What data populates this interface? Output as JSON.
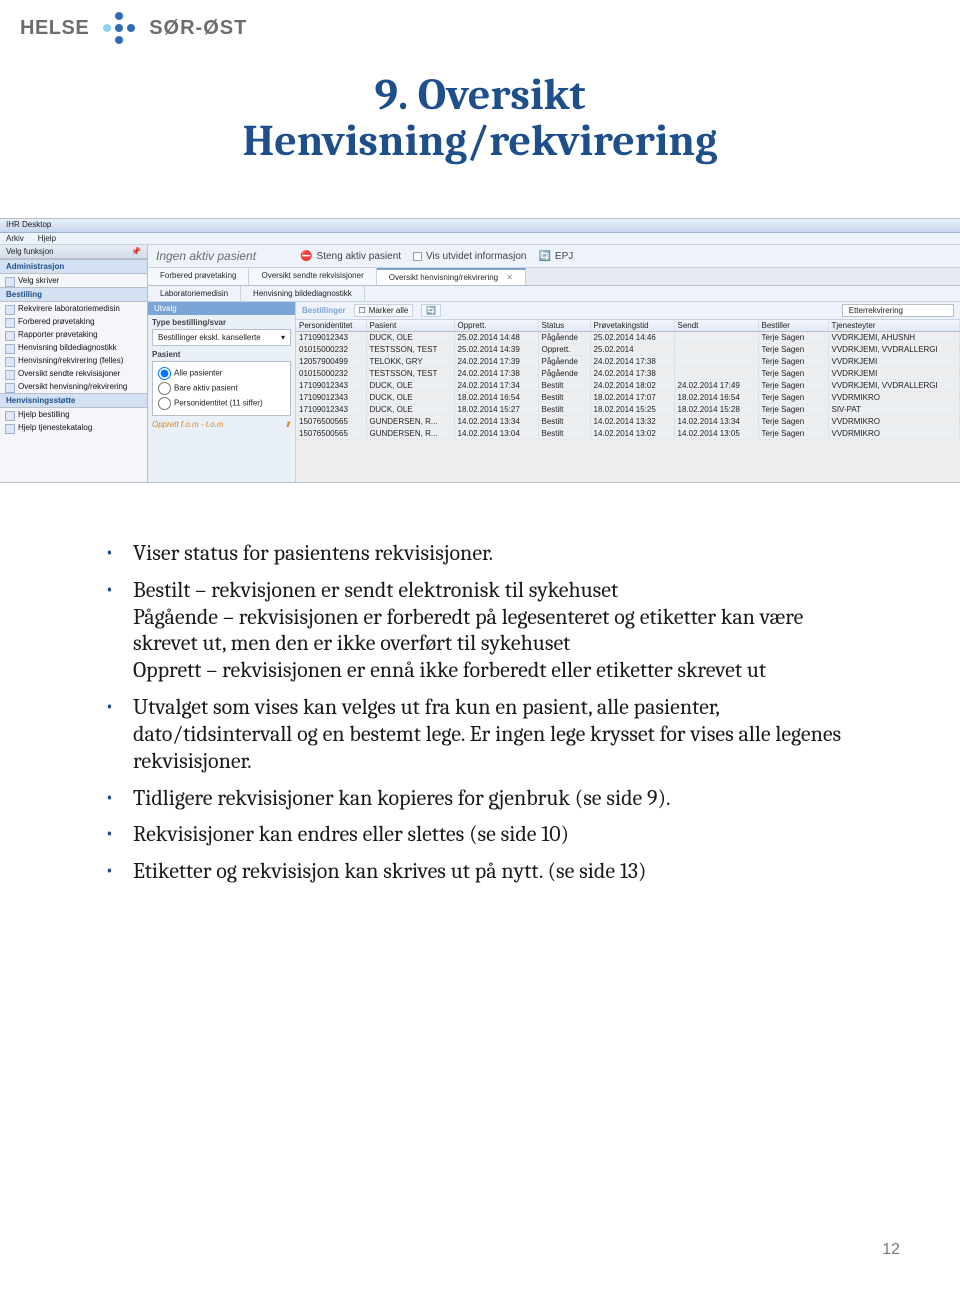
{
  "logo": {
    "left": "HELSE",
    "right": "SØR-ØST"
  },
  "title": {
    "line1": "9. Oversikt",
    "line2": "Henvisning/rekvirering"
  },
  "app": {
    "window_title": "IHR Desktop",
    "menus": [
      "Arkiv",
      "Hjelp"
    ],
    "sidebar": {
      "velg_funksjon_label": "Velg funksjon",
      "sections": [
        {
          "name": "Administrasjon",
          "items": [
            "Velg skriver"
          ]
        },
        {
          "name": "Bestilling",
          "items": [
            "Rekvirere laboratoriemedisin",
            "Forbered prøvetaking",
            "Rapporter prøvetaking",
            "Henvisning bildediagnostikk",
            "Henvisning/rekvirering (felles)",
            "Oversikt sendte rekvisisjoner",
            "Oversikt henvisning/rekvirering"
          ]
        },
        {
          "name": "Henvisningsstøtte",
          "items": [
            "Hjelp bestilling",
            "Hjelp tjenestekatalog"
          ]
        }
      ]
    },
    "patient_bar": {
      "no_active": "Ingen aktiv pasient",
      "close_pat": "Steng aktiv pasient",
      "show_ext": "Vis utvidet informasjon",
      "epj": "EPJ"
    },
    "tabs_row1": [
      "Forbered prøvetaking",
      "Oversikt sendte rekvisisjoner",
      "Oversikt henvisning/rekvirering"
    ],
    "tabs_row1_active": 2,
    "tabs_row2": [
      "Laboratoriemedisin",
      "Henvisning bildediagnostikk"
    ],
    "utvalg": {
      "title": "Utvalg",
      "type_label": "Type bestilling/svar",
      "type_value": "Bestillinger ekskl. kansellerte",
      "pasient_label": "Pasient",
      "radios": [
        {
          "label": "Alle pasienter",
          "checked": true
        },
        {
          "label": "Bare aktiv pasient",
          "checked": false
        },
        {
          "label": "Personidentitet (11 siffer)",
          "checked": false
        }
      ],
      "opprett_label": "Opprett f.o.m - t.o.m"
    },
    "toolbar": {
      "bestillinger": "Bestillinger",
      "marker_alle": "Marker alle",
      "etterrekvirering": "Etterrekvirering"
    },
    "columns": [
      "Personidentitet",
      "Pasient",
      "Opprett.",
      "Status",
      "Prøvetakingstid",
      "Sendt",
      "Bestiller",
      "Tjenesteyter"
    ],
    "rows": [
      [
        "17109012343",
        "DUCK, OLE",
        "25.02.2014 14:48",
        "Pågående",
        "25.02.2014 14:46",
        "",
        "Terje Sagen",
        "VVDRKJEMI, AHUSNH"
      ],
      [
        "01015000232",
        "TESTSSON, TEST",
        "25.02.2014 14:39",
        "Opprett.",
        "25.02.2014",
        "",
        "Terje Sagen",
        "VVDRKJEMI, VVDRALLERGI"
      ],
      [
        "12057900499",
        "TELOKK, GRY",
        "24.02.2014 17:39",
        "Pågående",
        "24.02.2014 17:38",
        "",
        "Terje Sagen",
        "VVDRKJEMI"
      ],
      [
        "01015000232",
        "TESTSSON, TEST",
        "24.02.2014 17:38",
        "Pågående",
        "24.02.2014 17:38",
        "",
        "Terje Sagen",
        "VVDRKJEMI"
      ],
      [
        "17109012343",
        "DUCK, OLE",
        "24.02.2014 17:34",
        "Bestilt",
        "24.02.2014 18:02",
        "24.02.2014 17:49",
        "Terje Sagen",
        "VVDRKJEMI, VVDRALLERGI"
      ],
      [
        "17109012343",
        "DUCK, OLE",
        "18.02.2014 16:54",
        "Bestilt",
        "18.02.2014 17:07",
        "18.02.2014 16:54",
        "Terje Sagen",
        "VVDRMIKRO"
      ],
      [
        "17109012343",
        "DUCK, OLE",
        "18.02.2014 15:27",
        "Bestilt",
        "18.02.2014 15:25",
        "18.02.2014 15:28",
        "Terje Sagen",
        "SIV-PAT"
      ],
      [
        "15076500565",
        "GUNDERSEN, R...",
        "14.02.2014 13:34",
        "Bestilt",
        "14.02.2014 13:32",
        "14.02.2014 13:34",
        "Terje Sagen",
        "VVDRMIKRO"
      ],
      [
        "15076500565",
        "GUNDERSEN, R...",
        "14.02.2014 13:04",
        "Bestilt",
        "14.02.2014 13:02",
        "14.02.2014 13:05",
        "Terje Sagen",
        "VVDRMIKRO"
      ]
    ]
  },
  "bullets": {
    "b1": "Viser status for pasientens rekvisisjoner.",
    "b2_lead": "Bestilt",
    "b2_rest": " rekvisjonen er sendt elektronisk til sykehuset",
    "b3_lead": "Pågående",
    "b3_rest": " rekvisisjonen er forberedt på legesenteret og etiketter kan være skrevet ut, men den er ikke overført til sykehuset",
    "b4_lead": "Opprett",
    "b4_rest": " rekvisisjonen er ennå ikke forberedt eller etiketter skrevet ut",
    "b5": "Utvalget som vises kan velges ut fra kun en pasient, alle pasienter, dato/tidsintervall og en bestemt lege. Er ingen lege krysset for vises alle legenes rekvisisjoner.",
    "b6": "Tidligere rekvisisjoner kan kopieres for gjenbruk (se side 9).",
    "b7": "Rekvisisjoner kan endres eller slettes (se side 10)",
    "b8": "Etiketter og rekvisisjon kan skrives ut på nytt. (se side 13)"
  },
  "page_number": "12"
}
